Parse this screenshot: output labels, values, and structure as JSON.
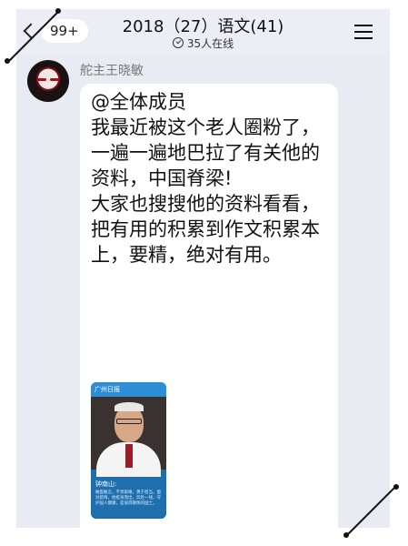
{
  "header": {
    "back_badge": "99+",
    "title": "2018（27）语文(41)",
    "online_status": "35人在线"
  },
  "message": {
    "sender": "舵主王晓敏",
    "text": "@全体成员\n我最近被这个老人圈粉了，一遍一遍地巴拉了有关他的资料，中国脊梁!\n大家也搜搜他的资料看看，把有用的积累到作文积累本上，要精，绝对有用。",
    "image": {
      "banner_text": "广州日报",
      "name_label": "钟南山:",
      "caption": "敢医敢言，不畏艰难，勇于担当，面对疫情，他挺身而出，奔赴一线，守护国人健康，是值得敬佩的国士。"
    }
  },
  "colors": {
    "chat_background": "#e9ebf3",
    "bubble": "#ffffff",
    "sender_name": "#777777",
    "photo_blue": "#1f6fae"
  },
  "icons": {
    "back": "chevron-left-icon",
    "online": "check-circle-icon",
    "menu": "hamburger-menu-icon"
  }
}
